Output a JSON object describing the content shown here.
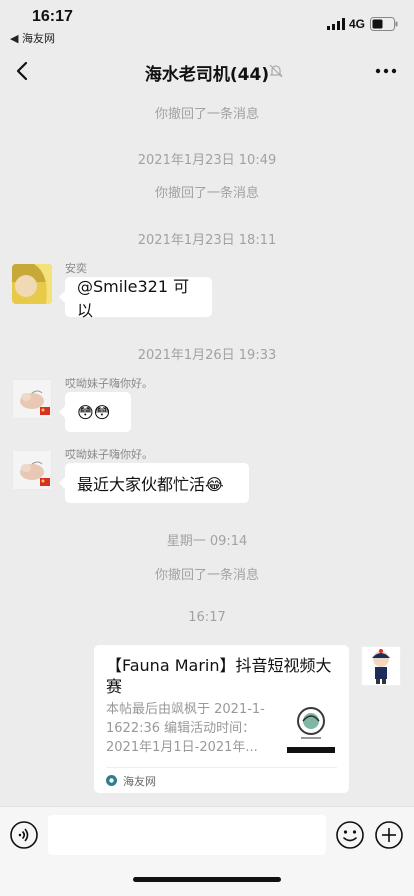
{
  "status_bar": {
    "time": "16:17",
    "back_app": "◀ 海友网",
    "network": "4G"
  },
  "nav": {
    "title": "海水老司机(44)"
  },
  "messages": {
    "recall_1": "你撤回了一条消息",
    "time_1": "2021年1月23日 10:49",
    "recall_2": "你撤回了一条消息",
    "time_2": "2021年1月23日 18:11",
    "sender_1": "安奕",
    "text_1": "@Smile321 可以",
    "time_3": "2021年1月26日 19:33",
    "sender_2": "哎呦妹子嗨你好。",
    "text_2": "😳😳",
    "sender_3": "哎呦妹子嗨你好。",
    "text_3": "最近大家伙都忙活😂",
    "time_4": "星期一 09:14",
    "recall_3": "你撤回了一条消息",
    "time_5": "16:17"
  },
  "card": {
    "title": "【Fauna Marin】抖音短视频大赛",
    "description": "本帖最后由飒枫于 2021-1-1622:36 编辑活动时间：2021年1月1日-2021年...",
    "source": "海友网"
  },
  "input": {
    "value": ""
  },
  "colors": {
    "background": "#ececec",
    "bubble": "#ffffff",
    "system_text": "#a2a2a2"
  }
}
